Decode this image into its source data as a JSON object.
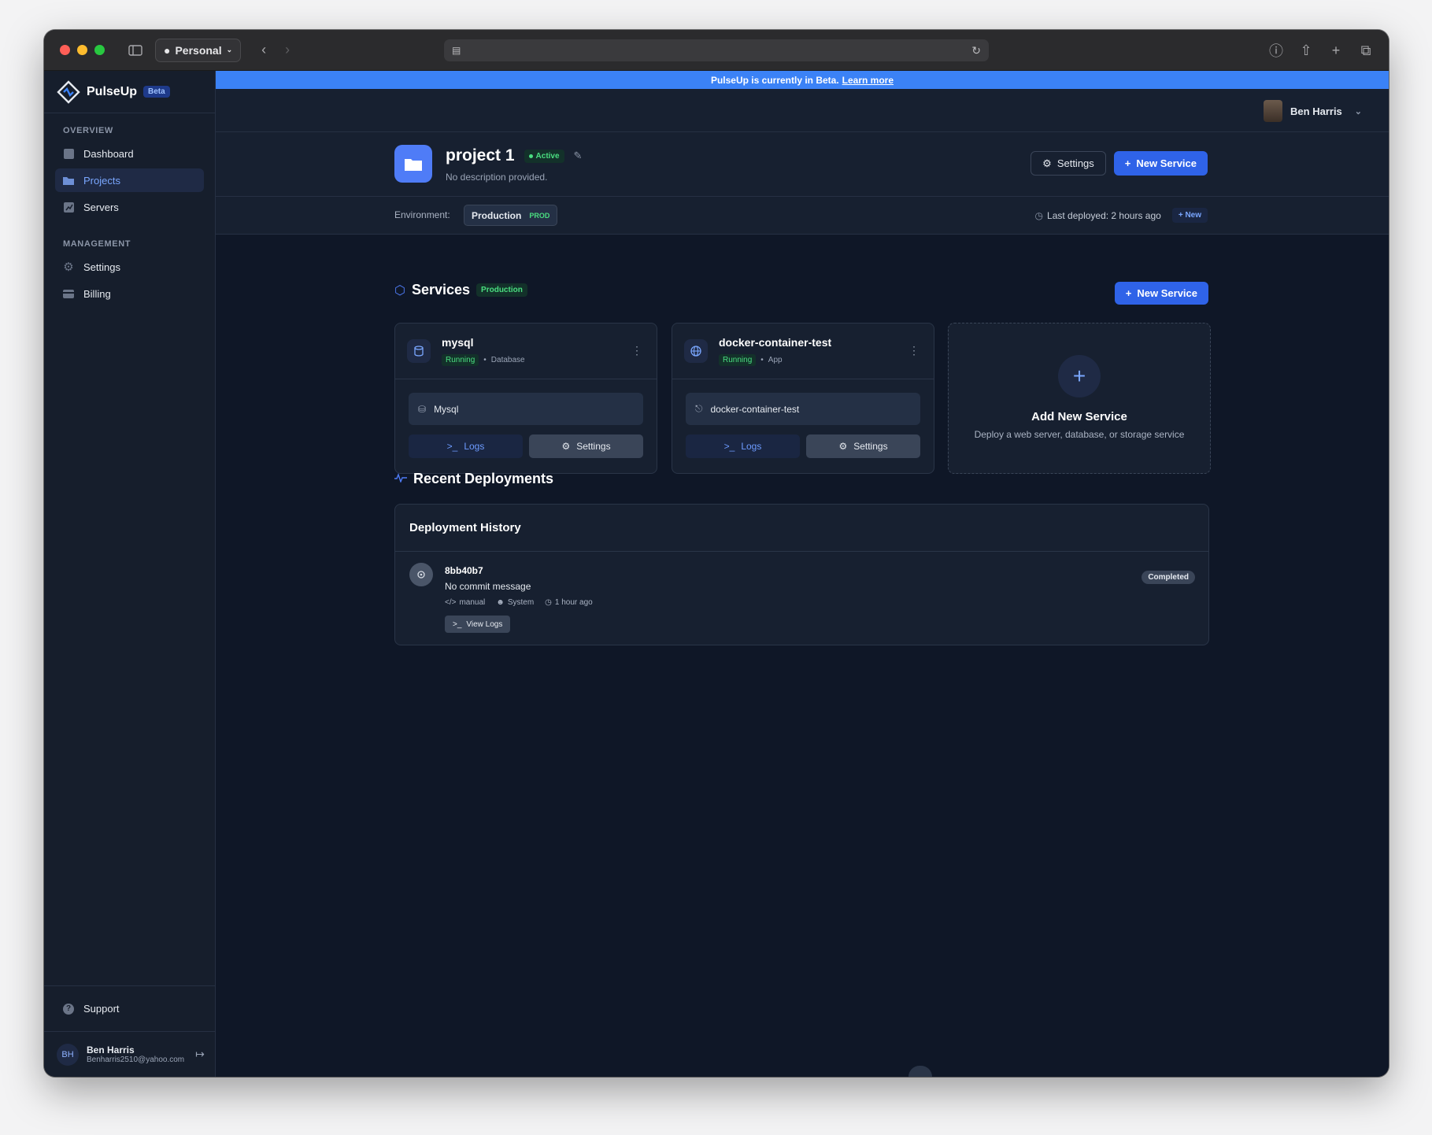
{
  "browser": {
    "profile": "Personal",
    "traffic_colors": [
      "#ff5f57",
      "#febc2e",
      "#28c840"
    ]
  },
  "sidebar": {
    "brand": "PulseUp",
    "brand_badge": "Beta",
    "sections": [
      {
        "title": "OVERVIEW",
        "items": [
          {
            "label": "Dashboard",
            "icon": "grid-icon",
            "active": false
          },
          {
            "label": "Projects",
            "icon": "folder-icon",
            "active": true
          },
          {
            "label": "Servers",
            "icon": "chart-icon",
            "active": false
          }
        ]
      },
      {
        "title": "MANAGEMENT",
        "items": [
          {
            "label": "Settings",
            "icon": "gear-icon",
            "active": false
          },
          {
            "label": "Billing",
            "icon": "card-icon",
            "active": false
          }
        ]
      }
    ],
    "support": "Support",
    "user": {
      "initials": "BH",
      "name": "Ben Harris",
      "email": "Benharris2510@yahoo.com"
    }
  },
  "banner": {
    "text": "PulseUp is currently in Beta.",
    "link": "Learn more"
  },
  "topbar": {
    "user_name": "Ben Harris"
  },
  "project": {
    "title": "project 1",
    "status": "Active",
    "description": "No description provided.",
    "settings_label": "Settings",
    "new_service_label": "New Service"
  },
  "environment": {
    "label": "Environment:",
    "name": "Production",
    "tag": "PROD",
    "last_deployed": "Last deployed: 2 hours ago",
    "new_label": "New"
  },
  "services": {
    "title": "Services",
    "tag": "Production",
    "new_service_label": "New Service",
    "cards": [
      {
        "name": "mysql",
        "status": "Running",
        "type": "Database",
        "field": "Mysql",
        "logs": "Logs",
        "settings": "Settings"
      },
      {
        "name": "docker-container-test",
        "status": "Running",
        "type": "App",
        "field": "docker-container-test",
        "logs": "Logs",
        "settings": "Settings"
      }
    ],
    "add": {
      "title": "Add New Service",
      "subtitle": "Deploy a web server, database, or storage service"
    }
  },
  "deployments": {
    "title": "Recent Deployments",
    "history_title": "Deployment History",
    "rows": [
      {
        "hash": "8bb40b7",
        "message": "No commit message",
        "trigger": "manual",
        "author": "System",
        "time": "1 hour ago",
        "status": "Completed",
        "view_logs": "View Logs"
      }
    ]
  },
  "colors": {
    "accent": "#2f63e8",
    "success": "#4ade80",
    "banner": "#3b82f6"
  }
}
